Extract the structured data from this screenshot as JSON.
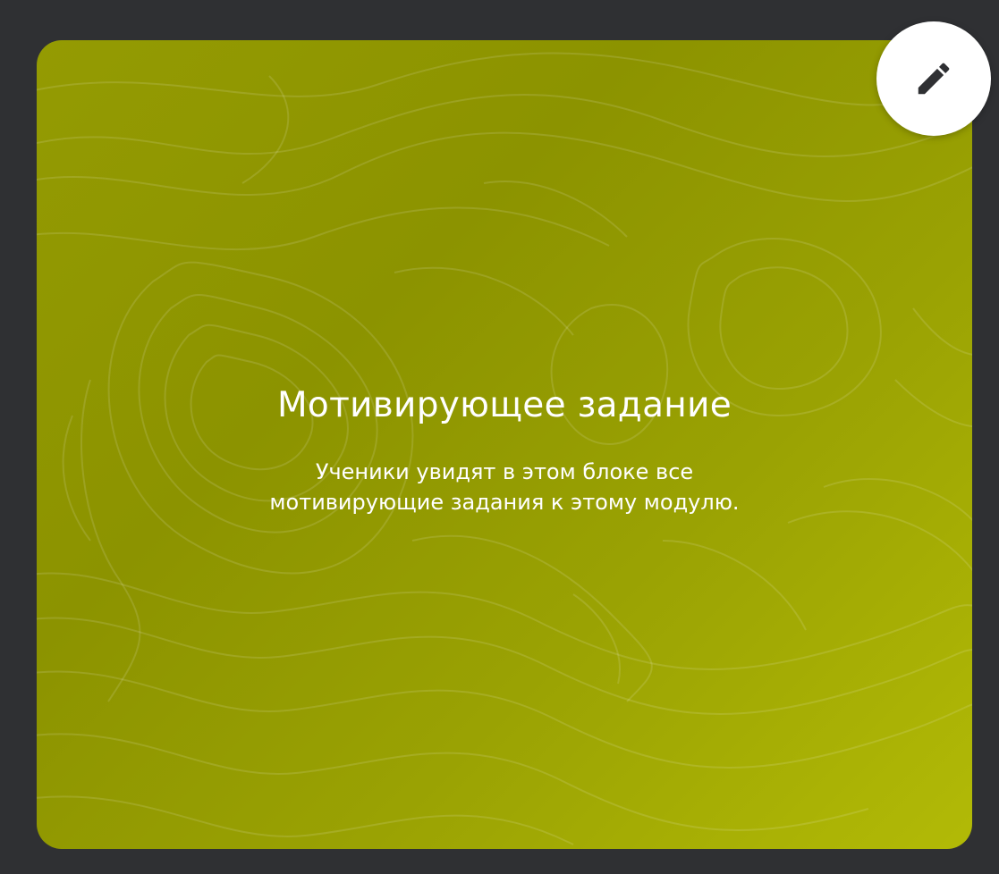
{
  "card": {
    "title": "Мотивирующее задание",
    "description": "Ученики увидят в этом блоке все мотивирующие задания к этому модулю.",
    "background_color": "#949b02",
    "text_color": "#ffffff"
  },
  "edit_button": {
    "icon": "pencil-icon"
  },
  "page_background": "#2f3033"
}
